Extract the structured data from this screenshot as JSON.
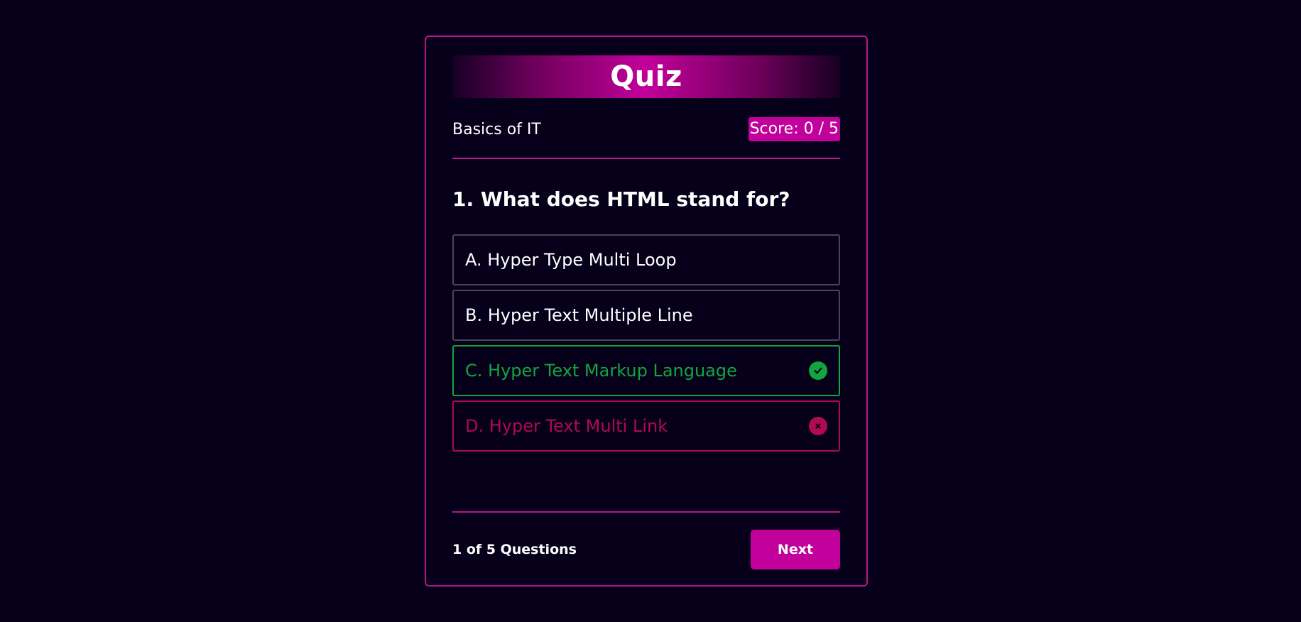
{
  "header": {
    "title": "Quiz"
  },
  "meta": {
    "topic": "Basics of IT",
    "score_label": "Score: 0 / 5"
  },
  "question": {
    "text": "1. What does HTML stand for?"
  },
  "options": [
    {
      "label": "A. Hyper Type Multi Loop",
      "state": "neutral"
    },
    {
      "label": "B. Hyper Text Multiple Line",
      "state": "neutral"
    },
    {
      "label": "C. Hyper Text Markup Language",
      "state": "correct",
      "icon": "check-circle-icon"
    },
    {
      "label": "D. Hyper Text Multi Link",
      "state": "wrong",
      "icon": "x-circle-icon"
    }
  ],
  "footer": {
    "progress": "1 of 5 Questions",
    "next_label": "Next"
  },
  "colors": {
    "background": "#06001a",
    "accent": "#c2009b",
    "correct": "#10a53f",
    "wrong": "#b00a50"
  }
}
